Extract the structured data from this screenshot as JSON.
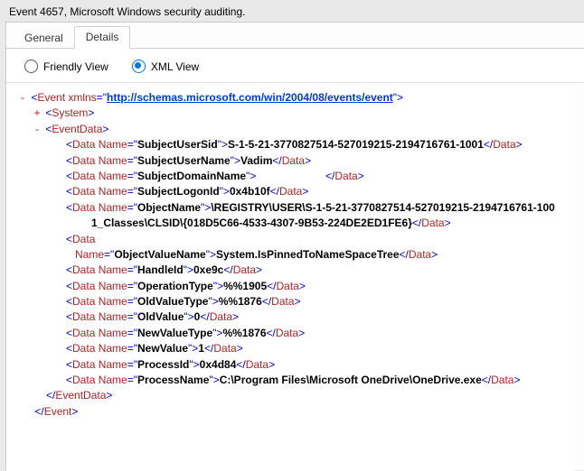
{
  "window": {
    "title": "Event 4657, Microsoft Windows security auditing."
  },
  "tabs": {
    "general": "General",
    "details": "Details"
  },
  "views": {
    "friendly": "Friendly View",
    "xml": "XML View"
  },
  "xml": {
    "event_open": "Event",
    "xmlns_attr": "xmlns",
    "xmlns_val": "http://schemas.microsoft.com/win/2004/08/events/event",
    "system_tag": "System",
    "eventdata_tag": "EventData",
    "data_tag": "Data",
    "name_attr": "Name",
    "data": [
      {
        "name": "SubjectUserSid",
        "value": "S-1-5-21-3770827514-527019215-2194716761-1001",
        "wrap": true
      },
      {
        "name": "SubjectUserName",
        "value": "Vadim"
      },
      {
        "name": "SubjectDomainName",
        "value": "",
        "spaced_close": true
      },
      {
        "name": "SubjectLogonId",
        "value": "0x4b10f"
      },
      {
        "name": "ObjectName",
        "value": "\\REGISTRY\\USER\\S-1-5-21-3770827514-527019215-2194716761-1001_Classes\\CLSID\\{018D5C66-4533-4307-9B53-224DE2ED1FE6}",
        "wrap": true
      },
      {
        "name": "ObjectValueName",
        "value": "System.IsPinnedToNameSpaceTree",
        "split_open": true
      },
      {
        "name": "HandleId",
        "value": "0xe9c"
      },
      {
        "name": "OperationType",
        "value": "%%1905"
      },
      {
        "name": "OldValueType",
        "value": "%%1876"
      },
      {
        "name": "OldValue",
        "value": "0"
      },
      {
        "name": "NewValueType",
        "value": "%%1876"
      },
      {
        "name": "NewValue",
        "value": "1"
      },
      {
        "name": "ProcessId",
        "value": "0x4d84"
      },
      {
        "name": "ProcessName",
        "value": "C:\\Program Files\\Microsoft OneDrive\\OneDrive.exe",
        "wrap": true
      }
    ]
  }
}
